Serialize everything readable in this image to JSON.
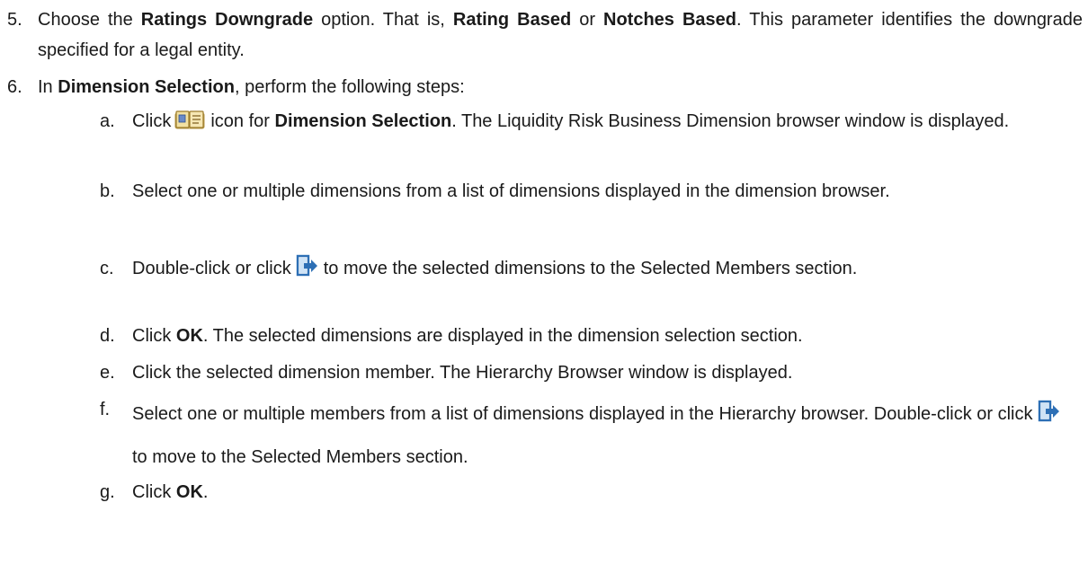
{
  "step5": {
    "number": "5.",
    "t1": "Choose the ",
    "b1": "Ratings Downgrade",
    "t2": " option. That is, ",
    "b2": "Rating Based",
    "t3": " or ",
    "b3": "Notches Based",
    "t4": ". This parameter identifies the downgrade specified for a legal entity."
  },
  "step6": {
    "number": "6.",
    "t1": "In ",
    "b1": "Dimension Selection",
    "t2": ", perform the following steps:"
  },
  "substeps": {
    "a": {
      "letter": "a.",
      "t1": "Click",
      "icon": "dimension-browser-icon",
      "t2": "icon for ",
      "b1": "Dimension Selection",
      "t3": ". The Liquidity Risk Business Dimension browser window is displayed."
    },
    "b": {
      "letter": "b.",
      "t1": "Select one or multiple dimensions from a list of dimensions displayed in the dimension browser."
    },
    "c": {
      "letter": "c.",
      "t1": "Double-click or click",
      "icon": "move-right-icon",
      "t2": "to move the selected dimensions to the Selected Members section."
    },
    "d": {
      "letter": "d.",
      "t1": "Click ",
      "b1": "OK",
      "t2": ". The selected dimensions are displayed in the dimension selection section."
    },
    "e": {
      "letter": "e.",
      "t1": "Click the selected dimension member. The Hierarchy Browser window is displayed."
    },
    "f": {
      "letter": "f.",
      "t1": "Select one or multiple members from a list of dimensions displayed in the Hierarchy browser. Double-click or click",
      "icon": "move-right-icon",
      "t2": "to move to the Selected Members section."
    },
    "g": {
      "letter": "g.",
      "t1": "Click ",
      "b1": "OK",
      "t2": "."
    }
  }
}
